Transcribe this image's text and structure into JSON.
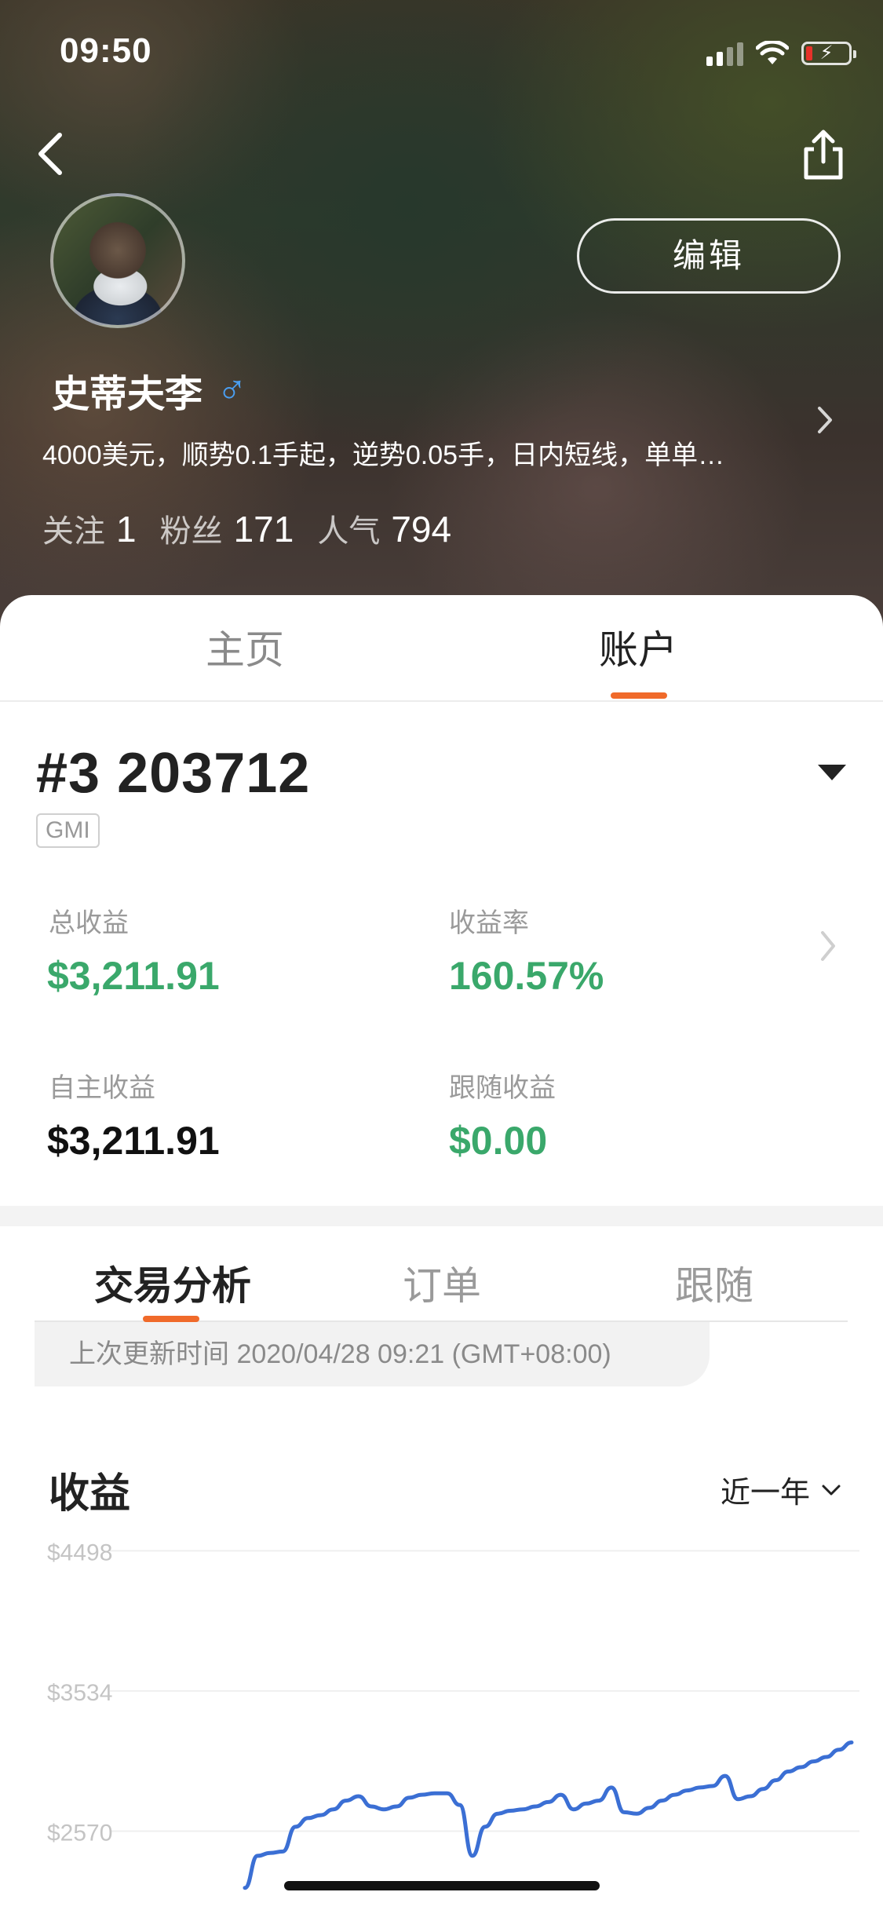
{
  "status_bar": {
    "time": "09:50"
  },
  "profile": {
    "edit_label": "编辑",
    "name": "史蒂夫李",
    "gender_symbol": "♂",
    "bio": "4000美元，顺势0.1手起，逆势0.05手，日内短线，单单…",
    "stats": [
      {
        "label": "关注",
        "value": "1"
      },
      {
        "label": "粉丝",
        "value": "171"
      },
      {
        "label": "人气",
        "value": "794"
      }
    ]
  },
  "main_tabs": [
    {
      "label": "主页",
      "active": false
    },
    {
      "label": "账户",
      "active": true
    }
  ],
  "account": {
    "number": "#3 203712",
    "broker": "GMI",
    "metrics": {
      "total_profit": {
        "label": "总收益",
        "value": "$3,211.91"
      },
      "return_rate": {
        "label": "收益率",
        "value": "160.57%"
      },
      "own_profit": {
        "label": "自主收益",
        "value": "$3,211.91"
      },
      "follow_profit": {
        "label": "跟随收益",
        "value": "$0.00"
      }
    }
  },
  "sub_tabs": [
    {
      "label": "交易分析",
      "active": true
    },
    {
      "label": "订单",
      "active": false
    },
    {
      "label": "跟随",
      "active": false
    }
  ],
  "last_update": "上次更新时间 2020/04/28 09:21 (GMT+08:00)",
  "profit_section": {
    "title": "收益",
    "range": "近一年"
  },
  "chart_data": {
    "type": "line",
    "title": "收益",
    "y_tick_labels": [
      "$4498",
      "$3534",
      "$2570"
    ],
    "ylim": [
      2000,
      4700
    ],
    "grid": true,
    "series": [
      {
        "color": "#3b6fd4",
        "values": [
          2180,
          2400,
          2420,
          2430,
          2600,
          2660,
          2680,
          2720,
          2780,
          2810,
          2740,
          2720,
          2740,
          2800,
          2820,
          2830,
          2830,
          2750,
          2400,
          2600,
          2690,
          2710,
          2720,
          2740,
          2770,
          2820,
          2720,
          2760,
          2780,
          2870,
          2700,
          2690,
          2730,
          2780,
          2820,
          2850,
          2870,
          2880,
          2950,
          2790,
          2810,
          2860,
          2920,
          2980,
          3010,
          3050,
          3080,
          3130,
          3180
        ]
      }
    ],
    "series_color": "#3b6fd4",
    "grid_color": "#efefef"
  }
}
